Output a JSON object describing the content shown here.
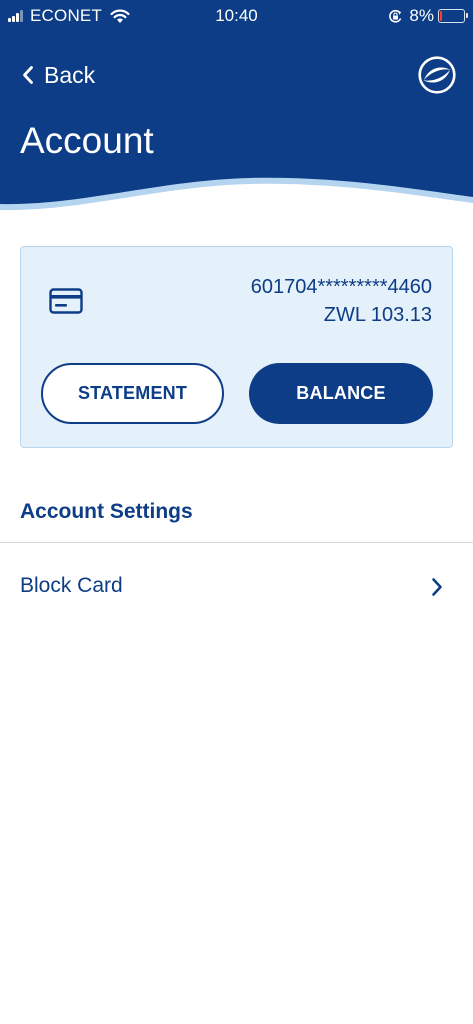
{
  "status_bar": {
    "carrier": "ECONET",
    "time": "10:40",
    "battery_percent": "8%",
    "battery_level": 0.08,
    "battery_color": "#ff3b30"
  },
  "nav": {
    "back_label": "Back",
    "back_icon": "chevron-left-icon",
    "logo_icon": "bank-logo-icon",
    "title": "Account"
  },
  "card": {
    "icon": "credit-card-icon",
    "number": "601704*********4460",
    "balance": "ZWL 103.13",
    "statement_label": "STATEMENT",
    "balance_label": "BALANCE"
  },
  "settings": {
    "title": "Account Settings",
    "items": [
      {
        "label": "Block Card",
        "icon": "chevron-right-icon"
      }
    ]
  },
  "colors": {
    "brand": "#0d3d86",
    "card_bg": "#e4f0fa",
    "wave_light": "#b5d4f0"
  }
}
